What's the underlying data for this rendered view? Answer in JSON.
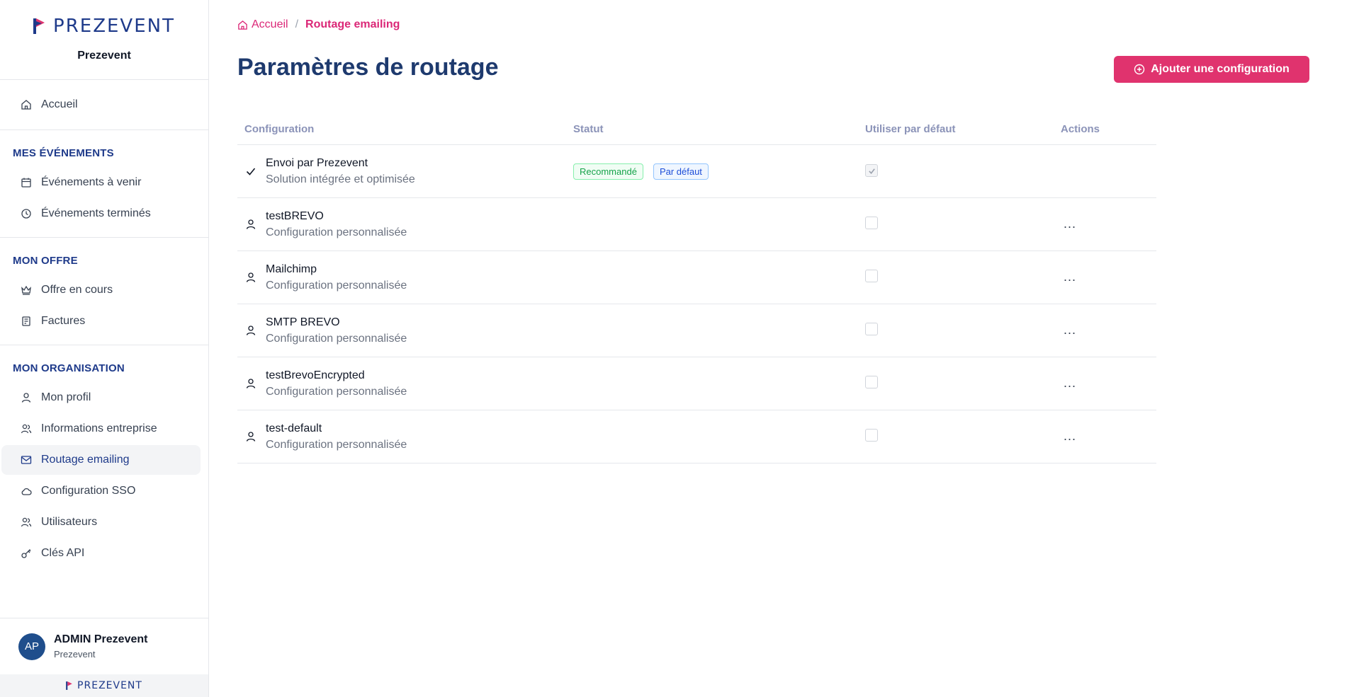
{
  "sidebar": {
    "brand": "PREZEVENT",
    "org_name": "Prezevent",
    "home": "Accueil",
    "sections": [
      {
        "title": "MES ÉVÉNEMENTS",
        "items": [
          "Événements à venir",
          "Événements terminés"
        ]
      },
      {
        "title": "MON OFFRE",
        "items": [
          "Offre en cours",
          "Factures"
        ]
      },
      {
        "title": "MON ORGANISATION",
        "items": [
          "Mon profil",
          "Informations entreprise",
          "Routage emailing",
          "Configuration SSO",
          "Utilisateurs",
          "Clés API"
        ]
      }
    ],
    "active_item": "Routage emailing",
    "user": {
      "initials": "AP",
      "name": "ADMIN Prezevent",
      "org": "Prezevent"
    },
    "footer_brand": "PREZEVENT"
  },
  "breadcrumb": {
    "home": "Accueil",
    "separator": "/",
    "current": "Routage emailing"
  },
  "page_title": "Paramètres de routage",
  "add_button": "Ajouter une configuration",
  "table": {
    "headers": [
      "Configuration",
      "Statut",
      "Utiliser par défaut",
      "Actions"
    ],
    "rows": [
      {
        "name": "Envoi par Prezevent",
        "desc": "Solution intégrée et optimisée",
        "icon": "check-icon",
        "badges": [
          "Recommandé",
          "Par défaut"
        ],
        "default": true,
        "actions": ""
      },
      {
        "name": "testBREVO",
        "desc": "Configuration personnalisée",
        "icon": "user-icon",
        "badges": [],
        "default": false,
        "actions": "..."
      },
      {
        "name": "Mailchimp",
        "desc": "Configuration personnalisée",
        "icon": "user-icon",
        "badges": [],
        "default": false,
        "actions": "..."
      },
      {
        "name": "SMTP BREVO",
        "desc": "Configuration personnalisée",
        "icon": "user-icon",
        "badges": [],
        "default": false,
        "actions": "..."
      },
      {
        "name": "testBrevoEncrypted",
        "desc": "Configuration personnalisée",
        "icon": "user-icon",
        "badges": [],
        "default": false,
        "actions": "..."
      },
      {
        "name": "test-default",
        "desc": "Configuration personnalisée",
        "icon": "user-icon",
        "badges": [],
        "default": false,
        "actions": "..."
      }
    ]
  },
  "colors": {
    "accent": "#e0336e",
    "primary": "#1e3a8a",
    "title": "#1e3a6e"
  }
}
